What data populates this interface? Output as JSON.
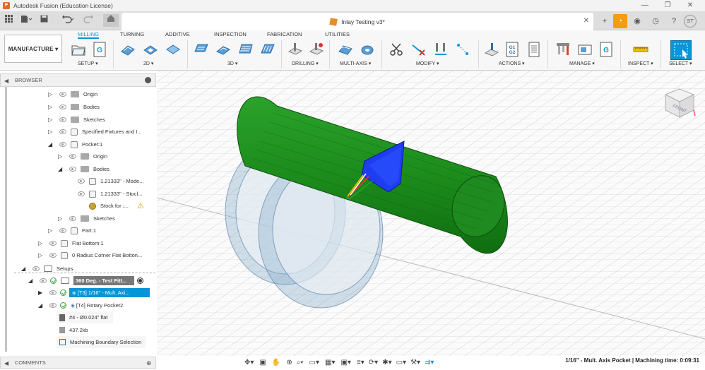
{
  "window": {
    "app_title": "Autodesk Fusion (Education License)",
    "minimize": "—",
    "maximize": "❐",
    "close": "✕"
  },
  "doc": {
    "title": "Inlay Testing v3*",
    "close": "✕"
  },
  "user": {
    "initials": "ST"
  },
  "workspace": {
    "label": "MANUFACTURE ▾"
  },
  "menu_tabs": [
    "MILLING",
    "TURNING",
    "ADDITIVE",
    "INSPECTION",
    "FABRICATION",
    "UTILITIES"
  ],
  "tool_groups": {
    "setup": "SETUP ▾",
    "g2d": "2D ▾",
    "g3d": "3D ▾",
    "drilling": "DRILLING ▾",
    "multiaxis": "MULTI-AXIS ▾",
    "modify": "MODIFY ▾",
    "actions": "ACTIONS ▾",
    "manage": "MANAGE ▾",
    "inspect": "INSPECT ▾",
    "select": "SELECT ▾"
  },
  "actions_icon_text": "G1\nG2",
  "setup_icon_text": "G",
  "browser": {
    "title": "BROWSER",
    "items": [
      {
        "label": "Origin"
      },
      {
        "label": "Bodies"
      },
      {
        "label": "Sketches"
      },
      {
        "label": "Specified Fixtures and I..."
      },
      {
        "label": "Pocket:1"
      },
      {
        "label": "Origin"
      },
      {
        "label": "Bodies"
      },
      {
        "label": "1.21333\" - Mode..."
      },
      {
        "label": "1.21333\" - Stocl..."
      },
      {
        "label": "Stock for :..."
      },
      {
        "label": "Sketches"
      },
      {
        "label": "Part:1"
      },
      {
        "label": "Flat Bottom:1"
      },
      {
        "label": "0 Radius Corner Flat Botton..."
      },
      {
        "label": "Setups"
      },
      {
        "label": "360 Deg. - Test Fitt..."
      },
      {
        "label": "[T3] 1/16\" - Mult. Axi..."
      },
      {
        "label": "[T4] Rotary Pocket2"
      },
      {
        "label": "#4 - Ø0.024\" flat"
      },
      {
        "label": "437.2kb"
      },
      {
        "label": "Machining Boundary Selection"
      }
    ]
  },
  "comments": {
    "title": "COMMENTS"
  },
  "viewcube": {
    "face": "FRONT"
  },
  "status": {
    "text": "1/16\" - Mult. Axis Pocket | Machining time: 0:09:31"
  },
  "colors": {
    "accent": "#0696d7",
    "part_green": "#1f8a1f",
    "pocket_blue": "#1e3df0",
    "stock_blue": "#7fa7c9",
    "warning": "#f2c200"
  }
}
